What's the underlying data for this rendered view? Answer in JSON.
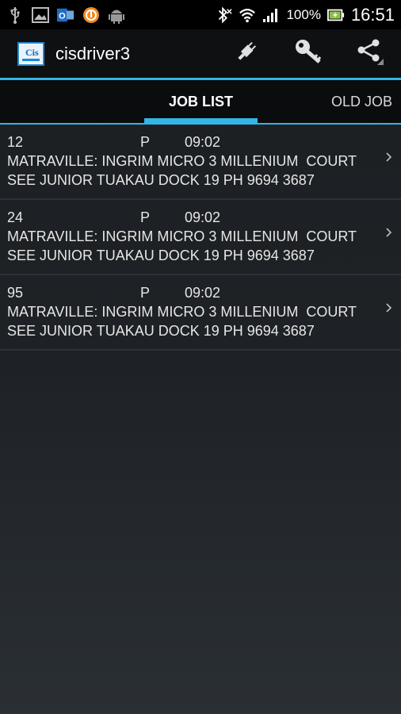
{
  "status": {
    "battery": "100%",
    "time": "16:51",
    "left_icons": [
      "usb-icon",
      "image-icon",
      "outlook-icon",
      "avast-icon",
      "android-icon"
    ],
    "right_icons": [
      "bluetooth-icon",
      "wifi-icon",
      "signal-icon",
      "battery-icon"
    ]
  },
  "app": {
    "title": "cisdriver3",
    "actions": [
      "plug-icon",
      "key-icon",
      "share-icon"
    ]
  },
  "tabs": [
    {
      "label": "JOB LIST",
      "active": true
    },
    {
      "label": "OLD JOB",
      "active": false
    }
  ],
  "jobs": [
    {
      "num": "12",
      "type": "P",
      "time": "09:02",
      "line1": "MATRAVILLE: INGRIM MICRO 3 MILLENIUM  COURT",
      "line2": "SEE JUNIOR TUAKAU DOCK 19 PH 9694 3687"
    },
    {
      "num": "24",
      "type": "P",
      "time": "09:02",
      "line1": "MATRAVILLE: INGRIM MICRO 3 MILLENIUM  COURT",
      "line2": "SEE JUNIOR TUAKAU DOCK 19 PH 9694 3687"
    },
    {
      "num": "95",
      "type": "P",
      "time": "09:02",
      "line1": "MATRAVILLE: INGRIM MICRO 3 MILLENIUM  COURT",
      "line2": "SEE JUNIOR TUAKAU DOCK 19 PH 9694 3687"
    }
  ],
  "colors": {
    "accent": "#33b5e5"
  }
}
